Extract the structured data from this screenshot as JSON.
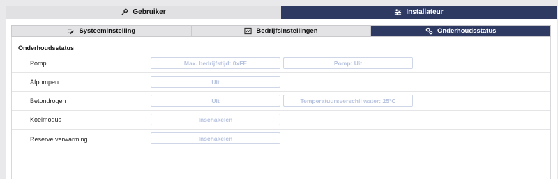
{
  "top_tabs": [
    {
      "label": "Gebruiker",
      "icon": "tools-icon",
      "active": false
    },
    {
      "label": "Installateur",
      "icon": "settings-sliders-icon",
      "active": true
    }
  ],
  "sub_tabs": [
    {
      "label": "Systeeminstelling",
      "icon": "settings-edit-icon",
      "active": false
    },
    {
      "label": "Bedrijfsinstellingen",
      "icon": "chart-window-icon",
      "active": false
    },
    {
      "label": "Onderhoudsstatus",
      "icon": "gears-icon",
      "active": true
    }
  ],
  "section_title": "Onderhoudsstatus",
  "rows": [
    {
      "label": "Pomp",
      "fields": [
        "Max. bedrijfstijd: 0xFE",
        "Pomp: Uit"
      ]
    },
    {
      "label": "Afpompen",
      "fields": [
        "Uit"
      ]
    },
    {
      "label": "Betondrogen",
      "fields": [
        "Uit",
        "Temperatuursverschil water: 25°C"
      ]
    },
    {
      "label": "Koelmodus",
      "fields": [
        "Inschakelen"
      ]
    },
    {
      "label": "Reserve verwarming",
      "fields": [
        "Inschakelen"
      ]
    }
  ],
  "colors": {
    "accent": "#2f3a63",
    "inactive_tab": "#e1e1e4",
    "field_border": "#cfd6e8",
    "field_text": "#b7c3df"
  }
}
